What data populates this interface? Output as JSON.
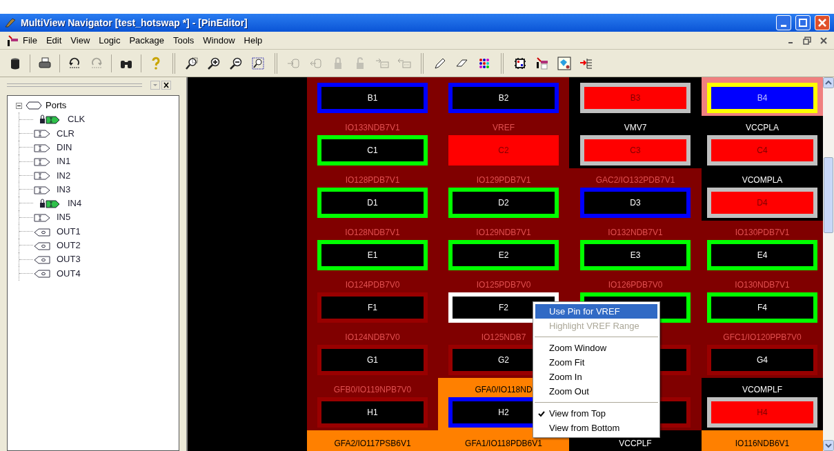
{
  "window": {
    "title": "MultiView Navigator [test_hotswap *] - [PinEditor]"
  },
  "menu_bar": [
    "File",
    "Edit",
    "View",
    "Logic",
    "Package",
    "Tools",
    "Window",
    "Help"
  ],
  "toolbar": [
    {
      "kind": "database",
      "disabled": false
    },
    {
      "kind": "sep"
    },
    {
      "kind": "printer",
      "disabled": false
    },
    {
      "kind": "sep"
    },
    {
      "kind": "undo",
      "disabled": false
    },
    {
      "kind": "redo",
      "disabled": true
    },
    {
      "kind": "sep"
    },
    {
      "kind": "binoculars",
      "disabled": false
    },
    {
      "kind": "sep"
    },
    {
      "kind": "help",
      "disabled": false
    },
    {
      "kind": "bar"
    },
    {
      "kind": "zoomwindow",
      "disabled": false
    },
    {
      "kind": "zoomin",
      "disabled": false
    },
    {
      "kind": "zoomout",
      "disabled": false
    },
    {
      "kind": "zoomfit",
      "disabled": false
    },
    {
      "kind": "bar"
    },
    {
      "kind": "import",
      "disabled": true
    },
    {
      "kind": "export",
      "disabled": true
    },
    {
      "kind": "lock",
      "disabled": true
    },
    {
      "kind": "unlock",
      "disabled": true
    },
    {
      "kind": "tablein",
      "disabled": true
    },
    {
      "kind": "tableout",
      "disabled": true
    },
    {
      "kind": "bar"
    },
    {
      "kind": "pencil",
      "disabled": false
    },
    {
      "kind": "eraser",
      "disabled": false
    },
    {
      "kind": "dots",
      "disabled": false
    },
    {
      "kind": "bar"
    },
    {
      "kind": "chip",
      "disabled": false
    },
    {
      "kind": "flow",
      "disabled": false
    },
    {
      "kind": "diagram",
      "disabled": false
    },
    {
      "kind": "list",
      "disabled": false
    }
  ],
  "tree": {
    "label": "Ports",
    "expanded": true,
    "children": [
      {
        "label": "CLK",
        "kind": "input-locked"
      },
      {
        "label": "CLR",
        "kind": "input"
      },
      {
        "label": "DIN",
        "kind": "input"
      },
      {
        "label": "IN1",
        "kind": "input"
      },
      {
        "label": "IN2",
        "kind": "input"
      },
      {
        "label": "IN3",
        "kind": "input"
      },
      {
        "label": "IN4",
        "kind": "input-locked"
      },
      {
        "label": "IN5",
        "kind": "input"
      },
      {
        "label": "OUT1",
        "kind": "output"
      },
      {
        "label": "OUT2",
        "kind": "output"
      },
      {
        "label": "OUT3",
        "kind": "output"
      },
      {
        "label": "OUT4",
        "kind": "output"
      }
    ]
  },
  "pin_rows": [
    {
      "kind": "top",
      "cells": [
        {
          "color": "#800000",
          "pin": "B1",
          "border": {
            "color": "#0000ff"
          },
          "fill": {
            "color": "#000000"
          }
        },
        {
          "color": "#800000",
          "pin": "B2",
          "border": {
            "color": "#0000ff"
          },
          "fill": {
            "color": "#000000"
          }
        },
        {
          "color": "#000000",
          "pin": "B3",
          "border": {
            "color": "#c0c0c0"
          },
          "fill": {
            "color": "#ff0000"
          }
        },
        {
          "color": "#f08080",
          "pin": "B4",
          "border": {
            "color": "#ffff00"
          },
          "fill": {
            "color": "#0000ff"
          }
        }
      ]
    },
    {
      "kind": "full",
      "cells": [
        {
          "label": "IO133NDB7V1",
          "color": "#800000",
          "pin": "C1",
          "border": {
            "color": "#00ff00"
          },
          "fill": {
            "color": "#000000"
          }
        },
        {
          "label": "VREF",
          "color": "#800000",
          "pin": "C2",
          "border": {
            "color": "#ff0000"
          },
          "fill": {
            "color": "#ff0000"
          }
        },
        {
          "label": "VMV7",
          "color": "#000000",
          "pin": "C3",
          "border": {
            "color": "#c0c0c0"
          },
          "fill": {
            "color": "#ff0000"
          }
        },
        {
          "label": "VCCPLA",
          "color": "#000000",
          "pin": "C4",
          "border": {
            "color": "#c0c0c0"
          },
          "fill": {
            "color": "#ff0000"
          }
        }
      ]
    },
    {
      "kind": "full",
      "cells": [
        {
          "label": "IO128PDB7V1",
          "color": "#800000",
          "pin": "D1",
          "border": {
            "color": "#00ff00"
          },
          "fill": {
            "color": "#000000"
          }
        },
        {
          "label": "IO129PDB7V1",
          "color": "#800000",
          "pin": "D2",
          "border": {
            "color": "#00ff00"
          },
          "fill": {
            "color": "#000000"
          }
        },
        {
          "label": "GAC2/IO132PDB7V1",
          "color": "#800000",
          "pin": "D3",
          "border": {
            "color": "#0000ff"
          },
          "fill": {
            "color": "#000000"
          }
        },
        {
          "label": "VCOMPLA",
          "color": "#000000",
          "pin": "D4",
          "border": {
            "color": "#c0c0c0"
          },
          "fill": {
            "color": "#ff0000"
          }
        }
      ]
    },
    {
      "kind": "full",
      "cells": [
        {
          "label": "IO128NDB7V1",
          "color": "#800000",
          "pin": "E1",
          "border": {
            "color": "#00ff00"
          },
          "fill": {
            "color": "#000000"
          }
        },
        {
          "label": "IO129NDB7V1",
          "color": "#800000",
          "pin": "E2",
          "border": {
            "color": "#00ff00"
          },
          "fill": {
            "color": "#000000"
          }
        },
        {
          "label": "IO132NDB7V1",
          "color": "#800000",
          "pin": "E3",
          "border": {
            "color": "#00ff00"
          },
          "fill": {
            "color": "#000000"
          }
        },
        {
          "label": "IO130PDB7V1",
          "color": "#800000",
          "pin": "E4",
          "border": {
            "color": "#00ff00"
          },
          "fill": {
            "color": "#000000"
          }
        }
      ]
    },
    {
      "kind": "full",
      "cells": [
        {
          "label": "IO124PDB7V0",
          "color": "#800000",
          "pin": "F1",
          "border": {
            "color": "#990000"
          },
          "fill": {
            "color": "#000000"
          }
        },
        {
          "label": "IO125PDB7V0",
          "color": "#800000",
          "pin": "F2",
          "border": {
            "color": "#ffffff"
          },
          "fill": {
            "color": "#000000"
          }
        },
        {
          "label": "IO126PDB7V0",
          "color": "#800000",
          "border": {
            "color": "#00ff00"
          },
          "fill": {
            "color": "#000000"
          }
        },
        {
          "label": "IO130NDB7V1",
          "color": "#800000",
          "pin": "F4",
          "border": {
            "color": "#00ff00"
          },
          "fill": {
            "color": "#000000"
          }
        }
      ]
    },
    {
      "kind": "full",
      "cells": [
        {
          "label": "IO124NDB7V0",
          "color": "#800000",
          "pin": "G1",
          "border": {
            "color": "#990000"
          },
          "fill": {
            "color": "#000000"
          }
        },
        {
          "label": "IO125NDB7",
          "color": "#800000",
          "pin": "G2",
          "border": {
            "color": "#990000"
          },
          "fill": {
            "color": "#000000"
          }
        },
        {
          "color": "#800000",
          "border": {
            "color": "#990000"
          },
          "fill": {
            "color": "#000000"
          }
        },
        {
          "label": "GFC1/IO120PPB7V0",
          "color": "#800000",
          "pin": "G4",
          "border": {
            "color": "#990000"
          },
          "fill": {
            "color": "#000000"
          }
        }
      ]
    },
    {
      "kind": "full",
      "cells": [
        {
          "label": "GFB0/IO119NPB7V0",
          "color": "#800000",
          "pin": "H1",
          "border": {
            "color": "#990000"
          },
          "fill": {
            "color": "#000000"
          }
        },
        {
          "label": "GFA0/IO118ND",
          "color": "#ff8000",
          "pin": "H2",
          "border": {
            "color": "#0000ff"
          },
          "fill": {
            "color": "#000000"
          }
        },
        {
          "color": "#800000",
          "border": {
            "color": "#990000"
          },
          "fill": {
            "color": "#000000"
          }
        },
        {
          "label": "VCOMPLF",
          "color": "#000000",
          "pin": "H4",
          "border": {
            "color": "#c0c0c0"
          },
          "fill": {
            "color": "#ff0000"
          }
        }
      ]
    },
    {
      "kind": "bottom",
      "cells": [
        {
          "label": "GFA2/IO117PSB6V1",
          "color": "#ff8000"
        },
        {
          "label": "GFA1/IO118PDB6V1",
          "color": "#ff8000"
        },
        {
          "label": "VCCPLF",
          "color": "#000000"
        },
        {
          "label": "IO116NDB6V1",
          "color": "#ff8000"
        }
      ]
    }
  ],
  "context_menu": [
    {
      "label": "Use Pin for VREF",
      "selected": true,
      "disabled": false,
      "checked": false
    },
    {
      "label": "Highlight VREF Range",
      "selected": false,
      "disabled": true,
      "checked": false
    },
    {
      "kind": "separator"
    },
    {
      "label": "Zoom Window",
      "selected": false,
      "disabled": false,
      "checked": false
    },
    {
      "label": "Zoom Fit",
      "selected": false,
      "disabled": false,
      "checked": false
    },
    {
      "label": "Zoom In",
      "selected": false,
      "disabled": false,
      "checked": false
    },
    {
      "label": "Zoom Out",
      "selected": false,
      "disabled": false,
      "checked": false
    },
    {
      "kind": "separator"
    },
    {
      "label": "View from Top",
      "selected": false,
      "disabled": false,
      "checked": true
    },
    {
      "label": "View from Bottom",
      "selected": false,
      "disabled": false,
      "checked": false
    }
  ]
}
